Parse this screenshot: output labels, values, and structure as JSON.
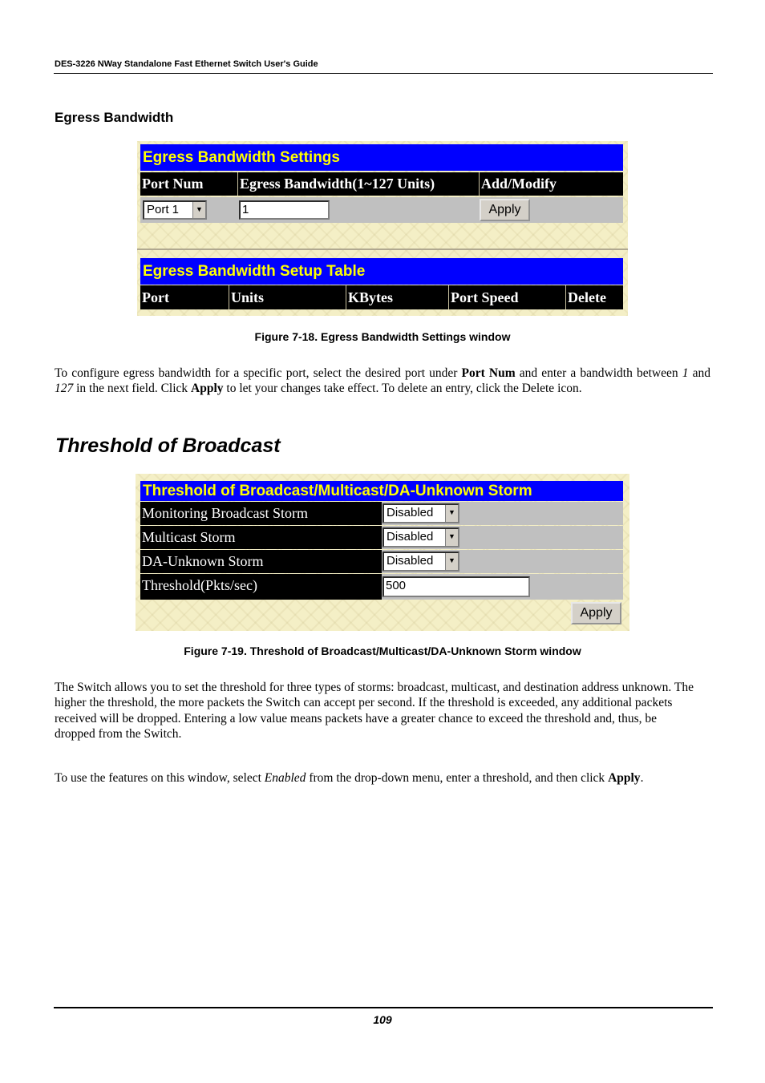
{
  "header": {
    "title": "DES-3226 NWay Standalone Fast Ethernet Switch User's Guide"
  },
  "section_egress": {
    "heading": "Egress Bandwidth",
    "settings_panel": {
      "title": "Egress Bandwidth Settings",
      "columns": [
        "Port Num",
        "Egress Bandwidth(1~127 Units)",
        "Add/Modify"
      ],
      "port_select_value": "Port 1",
      "bandwidth_value": "1",
      "apply_label": "Apply"
    },
    "setup_table": {
      "title": "Egress Bandwidth Setup Table",
      "columns": [
        "Port",
        "Units",
        "KBytes",
        "Port Speed",
        "Delete"
      ]
    },
    "caption": "Figure 7-18.  Egress Bandwidth Settings window",
    "paragraph": {
      "p1": "To configure egress bandwidth for a specific port, select the desired port under ",
      "b1": "Port Num",
      "p2": " and enter a bandwidth between ",
      "i1": "1",
      "p3": " and ",
      "i2": "127",
      "p4": " in the next field. Click ",
      "b2": "Apply",
      "p5": " to let your changes take effect. To delete an entry, click the Delete icon."
    }
  },
  "section_threshold": {
    "heading": "Threshold of Broadcast",
    "panel": {
      "title": "Threshold of Broadcast/Multicast/DA-Unknown Storm",
      "rows": [
        {
          "label": "Monitoring Broadcast Storm",
          "value": "Disabled"
        },
        {
          "label": "Multicast Storm",
          "value": "Disabled"
        },
        {
          "label": "DA-Unknown Storm",
          "value": "Disabled"
        },
        {
          "label": "Threshold(Pkts/sec)",
          "value": "500"
        }
      ],
      "apply_label": "Apply"
    },
    "caption": "Figure 7-19.  Threshold of Broadcast/Multicast/DA-Unknown Storm window",
    "paragraph1": "The Switch allows you to set the threshold for three types of storms: broadcast, multicast, and destination address unknown. The higher the threshold, the more packets the Switch can accept per second. If the threshold is exceeded, any additional packets received will be dropped. Entering a low value means packets have a greater chance to exceed the threshold and, thus, be dropped from the Switch.",
    "paragraph2": {
      "p1": "To use the features on this window, select ",
      "i1": "Enabled",
      "p2": " from the drop-down menu, enter a threshold, and then click ",
      "b1": "Apply",
      "p3": "."
    }
  },
  "footer": {
    "page_number": "109"
  }
}
